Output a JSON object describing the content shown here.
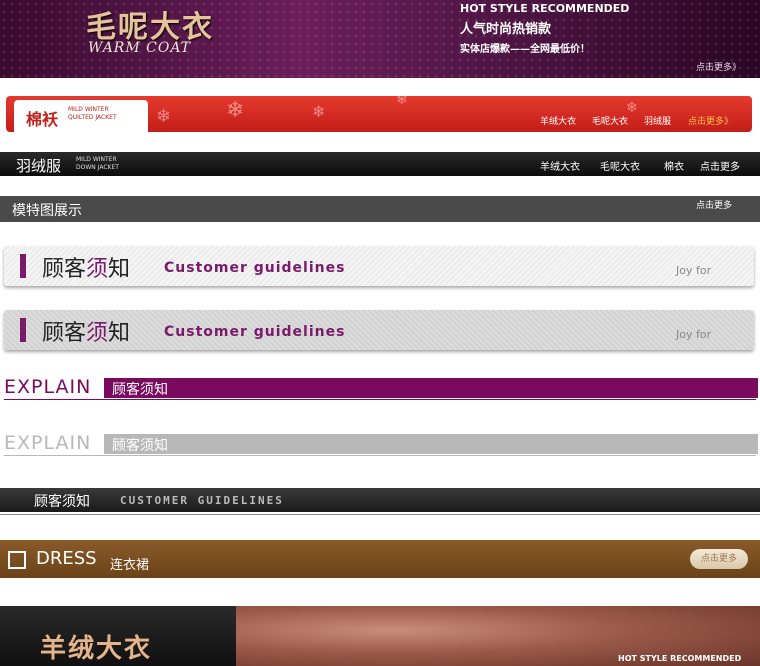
{
  "banner_warm_coat": {
    "title": "毛呢大衣",
    "subtitle": "WARM COAT",
    "hot_label": "HOT STYLE RECOMMENDED",
    "line1": "人气时尚热销款",
    "line2": "实体店爆款——全网最低价！",
    "more": "点击更多》",
    "colors": {
      "background": "#6b1f5b",
      "title": "#e6c49a"
    }
  },
  "banner_cotton": {
    "title": "棉袄",
    "en_line1": "MILD WINTER",
    "en_line2": "QUILTED JACKET",
    "links": [
      "羊绒大衣",
      "毛呢大衣",
      "羽绒服"
    ],
    "more": "点击更多》",
    "colors": {
      "background": "#c41e1a",
      "more": "#ffc24a"
    }
  },
  "banner_down": {
    "title": "羽绒服",
    "en_line1": "MILD WINTER",
    "en_line2": "DOWN JACKET",
    "links": [
      "羊绒大衣",
      "毛呢大衣",
      "棉衣",
      "点击更多"
    ]
  },
  "banner_model": {
    "title": "模特图展示",
    "more": "点击更多"
  },
  "guidelines_bars": [
    {
      "cn_prefix": "顾客",
      "cn_accent": "须",
      "cn_suffix": "知",
      "en": "Customer guidelines",
      "right": "Joy for"
    },
    {
      "cn_prefix": "顾客",
      "cn_accent": "须",
      "cn_suffix": "知",
      "en": "Customer guidelines",
      "right": "Joy for"
    }
  ],
  "explain_bars": [
    {
      "label": "EXPLAIN",
      "cn": "顾客须知",
      "color": "#7a0a5e"
    },
    {
      "label": "EXPLAIN",
      "cn": "顾客须知",
      "color": "#b8b8b8"
    }
  ],
  "customer_bar": {
    "cn": "顾客须知",
    "en": "CUSTOMER GUIDELINES"
  },
  "dress_bar": {
    "title": "DRESS",
    "cn": "连衣裙",
    "button": "点击更多",
    "colors": {
      "background": "#7a4e20"
    }
  },
  "fur_banner": {
    "title": "羊绒大衣",
    "hot_label": "HOT STYLE RECOMMENDED"
  }
}
